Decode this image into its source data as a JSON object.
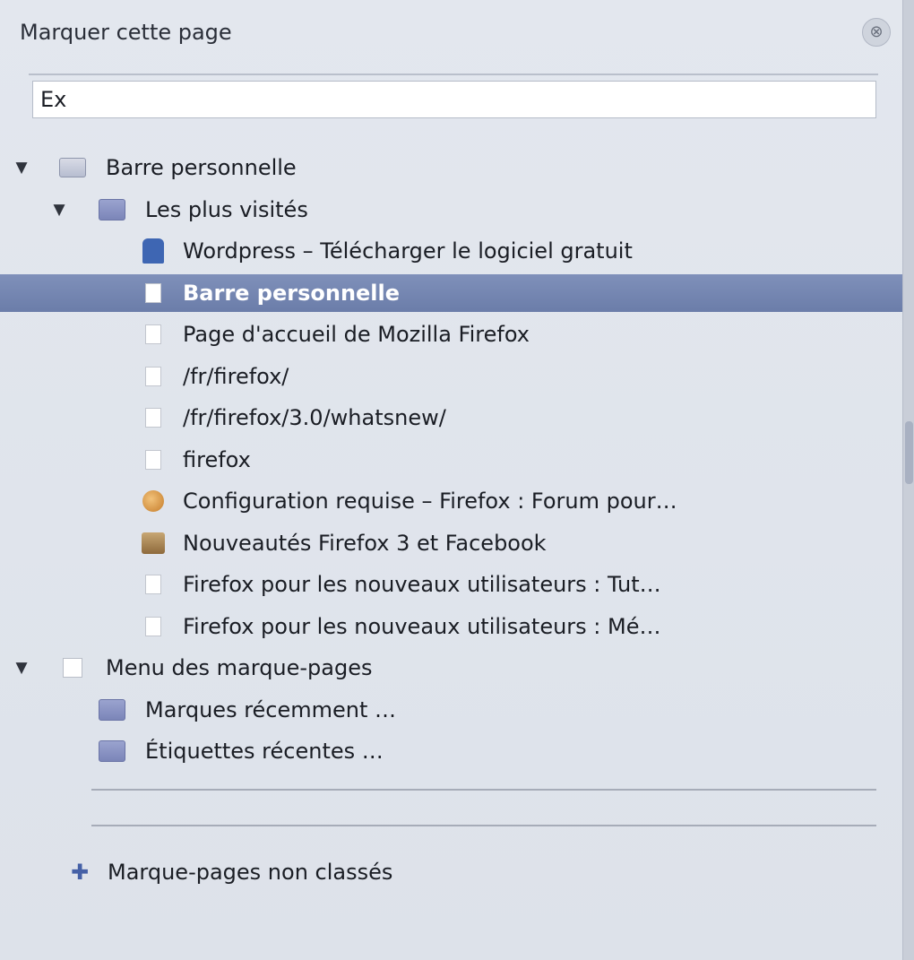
{
  "panel": {
    "title": "Marquer cette page",
    "close_icon": "⊗",
    "search": {
      "value": "Ex",
      "placeholder": ""
    }
  },
  "tree": [
    {
      "level": 0,
      "twisty": "▼",
      "icon": "star-folder-icon",
      "label": "Barre personnelle",
      "selected": false
    },
    {
      "level": 1,
      "twisty": "▼",
      "icon": "folder-icon",
      "label": "Les plus visités",
      "selected": false
    },
    {
      "level": 2,
      "twisty": "",
      "icon": "site-icon",
      "label": "Wordpress – Télécharger le logiciel gratuit",
      "selected": false
    },
    {
      "level": 2,
      "twisty": "",
      "icon": "page-icon",
      "label": "Barre personnelle",
      "selected": true
    },
    {
      "level": 2,
      "twisty": "",
      "icon": "firefox-icon",
      "label": "Page d'accueil de Mozilla Firefox",
      "selected": false
    },
    {
      "level": 2,
      "twisty": "",
      "icon": "page-icon",
      "label": "/fr/firefox/",
      "selected": false
    },
    {
      "level": 2,
      "twisty": "",
      "icon": "page-icon",
      "label": "/fr/firefox/3.0/whatsnew/",
      "selected": false
    },
    {
      "level": 2,
      "twisty": "",
      "icon": "page-icon",
      "label": "firefox",
      "selected": false
    },
    {
      "level": 2,
      "twisty": "",
      "icon": "orange-icon",
      "label": "Configuration requise – Firefox : Forum pour…",
      "selected": false
    },
    {
      "level": 2,
      "twisty": "",
      "icon": "brown-icon",
      "label": "Nouveautés Firefox 3 et Facebook",
      "selected": false
    },
    {
      "level": 2,
      "twisty": "",
      "icon": "page-icon",
      "label": "Firefox pour les nouveaux utilisateurs : Tut…",
      "selected": false
    },
    {
      "level": 2,
      "twisty": "",
      "icon": "page-icon",
      "label": "Firefox pour les nouveaux utilisateurs : Mé…",
      "selected": false
    },
    {
      "level": 0,
      "twisty": "▼",
      "icon": "empty-folder-icon",
      "label": "Menu des marque-pages",
      "selected": false
    },
    {
      "level": 1,
      "twisty": "",
      "icon": "folder-icon",
      "label": "Marques récemment …",
      "selected": false
    },
    {
      "level": 1,
      "twisty": "",
      "icon": "folder-icon",
      "label": "Étiquettes récentes …",
      "selected": false
    }
  ],
  "footer": {
    "icon": "plus-icon",
    "label": "Marque-pages non classés"
  }
}
